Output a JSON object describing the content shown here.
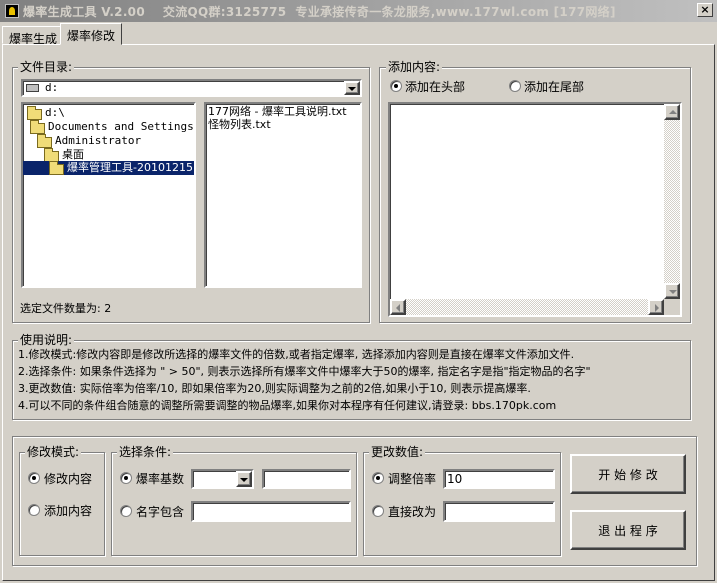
{
  "window": {
    "title": "爆率生成工具 V.2.00    交流QQ群:3125775  专业承接传奇一条龙服务,www.177wl.com [177网络]",
    "close": "×"
  },
  "tabs": [
    {
      "label": "爆率生成"
    },
    {
      "label": "爆率修改"
    }
  ],
  "file_dir": {
    "legend": "文件目录:",
    "drive": "d:",
    "tree": [
      {
        "label": "d:\\"
      },
      {
        "label": "Documents and Settings"
      },
      {
        "label": "Administrator"
      },
      {
        "label": "桌面"
      },
      {
        "label": "爆率管理工具-20101215"
      }
    ],
    "files": [
      "177网络 - 爆率工具说明.txt",
      "怪物列表.txt"
    ],
    "selected_count": "选定文件数量为: 2"
  },
  "add_content": {
    "legend": "添加内容:",
    "radio_head": "添加在头部",
    "radio_tail": "添加在尾部"
  },
  "instructions": {
    "legend": "使用说明:",
    "lines": [
      "1.修改模式:修改内容即是修改所选择的爆率文件的倍数,或者指定爆率, 选择添加内容则是直接在爆率文件添加文件.",
      "2.选择条件: 如果条件选择为 \" > 50\", 则表示选择所有爆率文件中爆率大于50的爆率, 指定名字是指\"指定物品的名字\"",
      "3.更改数值: 实际倍率为倍率/10, 即如果倍率为20,则实际调整为之前的2倍,如果小于10, 则表示提高爆率.",
      "4.可以不同的条件组合随意的调整所需要调整的物品爆率,如果你对本程序有任何建议,请登录: bbs.170pk.com"
    ]
  },
  "modify_mode": {
    "legend": "修改模式:",
    "opt_modify": "修改内容",
    "opt_add": "添加内容"
  },
  "condition": {
    "legend": "选择条件:",
    "opt_base": "爆率基数",
    "opt_name": "名字包含"
  },
  "change_value": {
    "legend": "更改数值:",
    "opt_ratio": "调整倍率",
    "ratio_value": "10",
    "opt_direct": "直接改为"
  },
  "actions": {
    "start": "开 始 修 改",
    "exit": "退 出 程 序"
  }
}
